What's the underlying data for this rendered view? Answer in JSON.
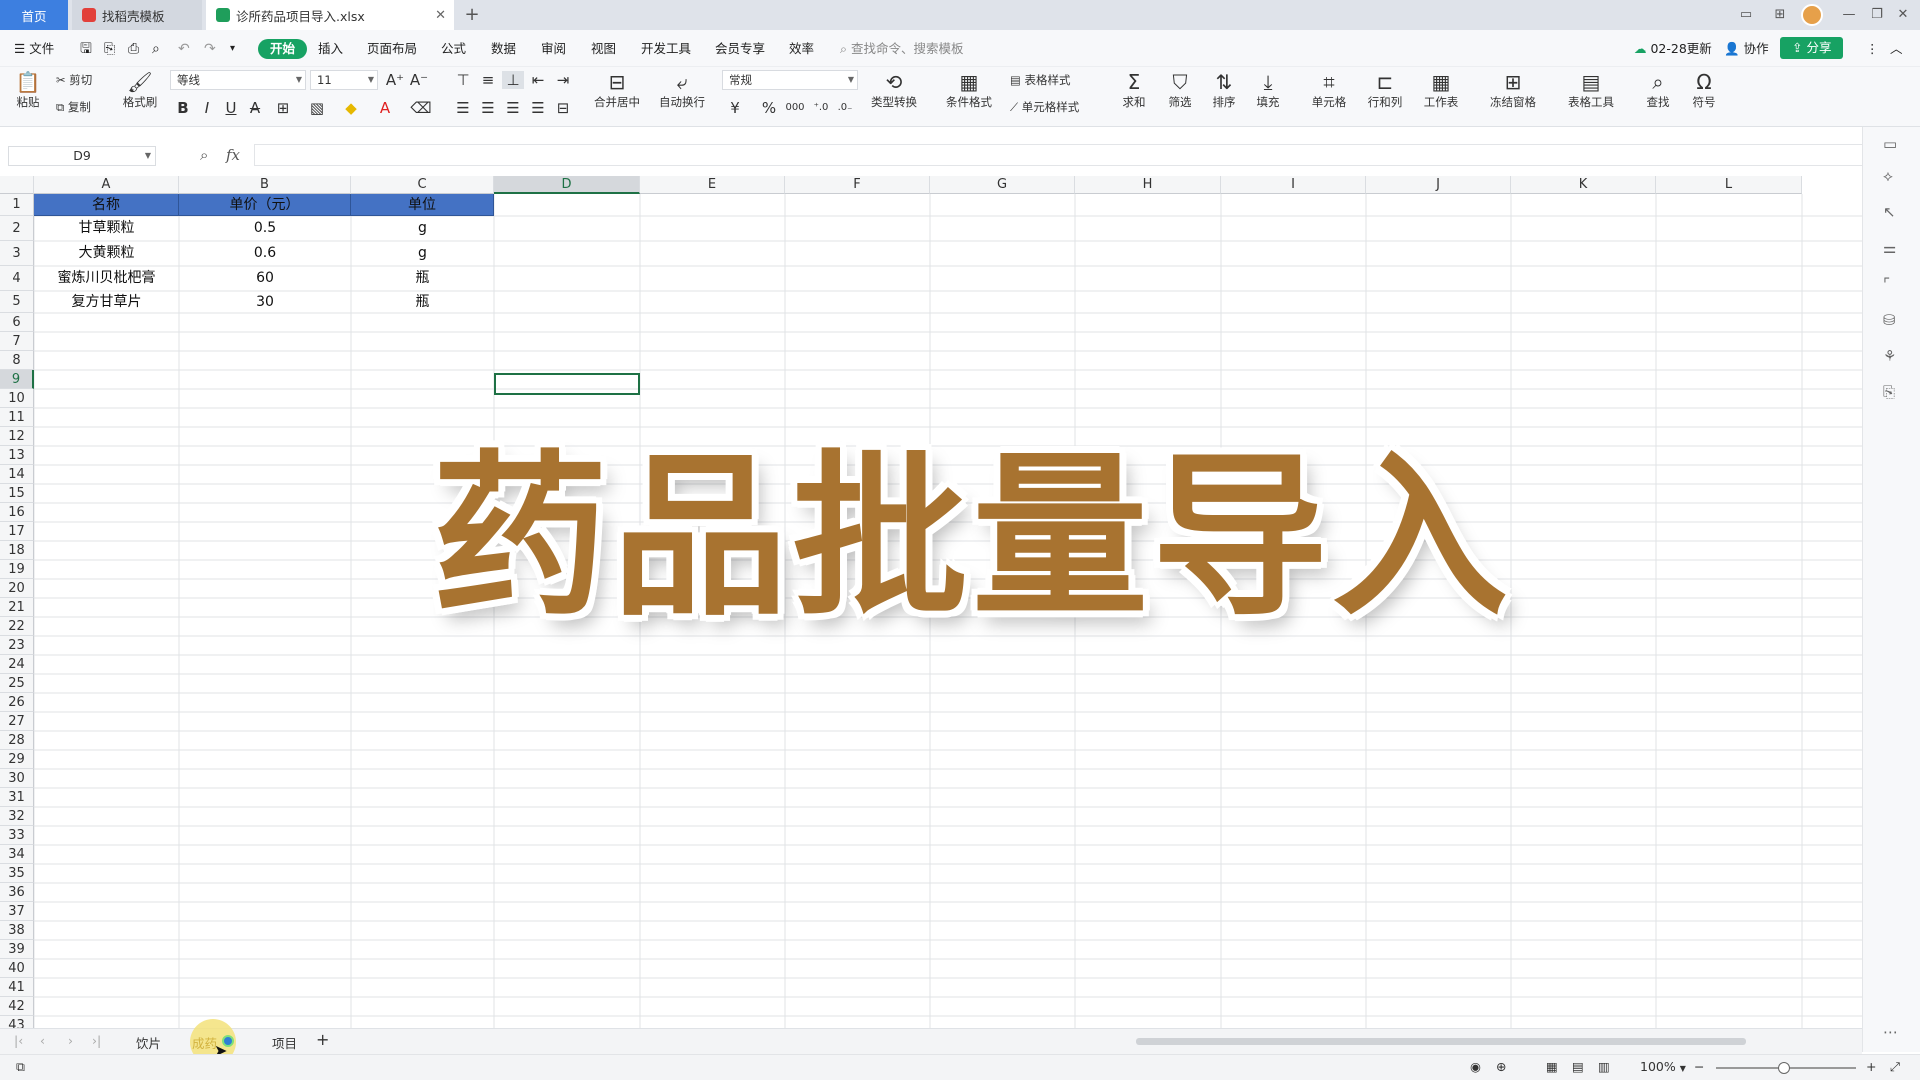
{
  "tabs": [
    {
      "label": "首页",
      "active": false
    },
    {
      "label": "找稻壳模板",
      "active": false
    },
    {
      "label": "诊所药品项目导入.xlsx",
      "active": true
    }
  ],
  "menu": {
    "file": "文件",
    "items": [
      "开始",
      "插入",
      "页面布局",
      "公式",
      "数据",
      "审阅",
      "视图",
      "开发工具",
      "会员专享",
      "效率"
    ],
    "search_placeholder": "查找命令、搜索模板",
    "update": "02-28更新",
    "collab": "协作",
    "share": "分享"
  },
  "ribbon": {
    "paste": "粘贴",
    "cut": "剪切",
    "copy": "复制",
    "format_painter": "格式刷",
    "font_name": "等线",
    "font_size": "11",
    "merge": "合并居中",
    "wrap": "自动换行",
    "number_format": "常规",
    "convert": "类型转换",
    "cond_format": "条件格式",
    "table_style": "表格样式",
    "cell_style": "单元格样式",
    "sum": "求和",
    "filter": "筛选",
    "sort": "排序",
    "fill": "填充",
    "cell": "单元格",
    "rowcol": "行和列",
    "worksheet": "工作表",
    "freeze": "冻结窗格",
    "table_tools": "表格工具",
    "find": "查找",
    "symbol": "符号"
  },
  "formula_bar": {
    "cell_ref": "D9",
    "fx": "fx",
    "value": ""
  },
  "columns": [
    "A",
    "B",
    "C",
    "D",
    "E",
    "F",
    "G",
    "H",
    "I",
    "J",
    "K",
    "L"
  ],
  "selected_cell": "D9",
  "table": {
    "headers": [
      "名称",
      "单价（元）",
      "单位"
    ],
    "rows": [
      [
        "甘草颗粒",
        "0.5",
        "g"
      ],
      [
        "大黄颗粒",
        "0.6",
        "g"
      ],
      [
        "蜜炼川贝枇杷膏",
        "60",
        "瓶"
      ],
      [
        "复方甘草片",
        "30",
        "瓶"
      ]
    ],
    "header_color": "#4472c4"
  },
  "overlay_title": "药品批量导入",
  "sheets": [
    {
      "label": "饮片",
      "active": false
    },
    {
      "label": "成药",
      "active": true
    },
    {
      "label": "项目",
      "active": false
    }
  ],
  "status": {
    "zoom": "100%"
  },
  "colors": {
    "accent": "#17a263",
    "title": "#a87330",
    "selection": "#1e7145"
  }
}
